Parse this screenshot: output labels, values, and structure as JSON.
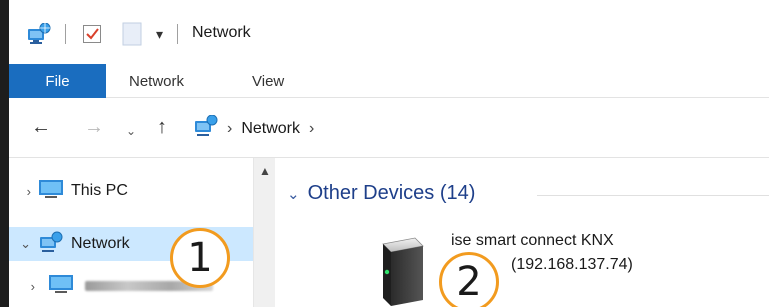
{
  "window": {
    "title": "Network"
  },
  "ribbon": {
    "tabs": [
      "File",
      "Network",
      "View"
    ]
  },
  "address": {
    "crumbs": [
      "Network"
    ]
  },
  "sidebar": {
    "items": [
      {
        "label": "This PC",
        "icon": "monitor-icon",
        "expanded": false,
        "selected": false
      },
      {
        "label": "Network",
        "icon": "network-icon",
        "expanded": true,
        "selected": true
      },
      {
        "label": "",
        "icon": "monitor-icon",
        "expanded": false,
        "selected": false
      }
    ]
  },
  "content": {
    "group_title": "Other Devices (14)",
    "device": {
      "name": "ise smart connect KNX",
      "ip": "(192.168.137.74)",
      "icon": "server-device-icon"
    }
  },
  "callouts": [
    "1",
    "2"
  ],
  "colors": {
    "accent": "#1a6dbf",
    "selection": "#cce8ff",
    "callout": "#f29b1f",
    "group_text": "#1e3f8a"
  }
}
